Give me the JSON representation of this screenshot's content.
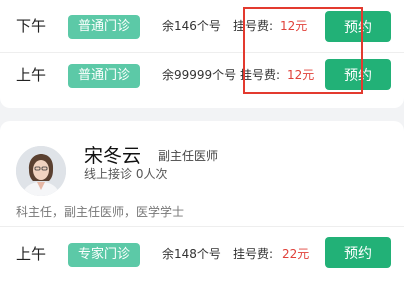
{
  "top_card": {
    "slots": [
      {
        "period": "下午",
        "clinic_type": "普通门诊",
        "remaining": "余146个号",
        "fee_label": "挂号费:",
        "fee": "12元",
        "book_label": "预约"
      },
      {
        "period": "上午",
        "clinic_type": "普通门诊",
        "remaining": "余99999个号",
        "fee_label": "挂号费:",
        "fee": "12元",
        "book_label": "预约"
      }
    ]
  },
  "doctor": {
    "name": "宋冬云",
    "title": "副主任医师",
    "consult_info": "线上接诊 0人次",
    "intro": "科主任，副主任医师，医学学士",
    "slots": [
      {
        "period": "上午",
        "clinic_type": "专家门诊",
        "remaining": "余148个号",
        "fee_label": "挂号费:",
        "fee": "22元",
        "book_label": "预约"
      }
    ]
  },
  "colors": {
    "tag_bg": "#5cc9a7",
    "button_bg": "#22b177",
    "fee_text": "#e0413a",
    "highlight_border": "#e33a2f"
  },
  "icons": {
    "avatar": "doctor-avatar"
  }
}
